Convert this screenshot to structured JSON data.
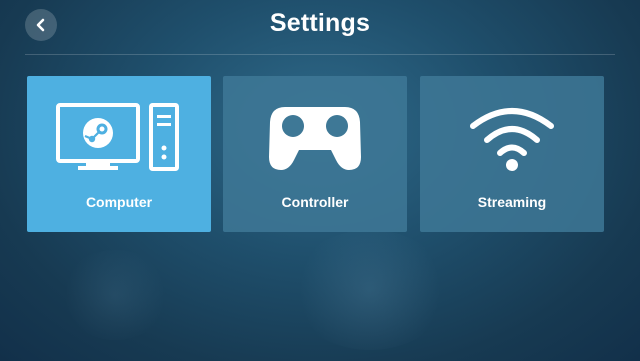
{
  "header": {
    "title": "Settings",
    "back_icon": "chevron-left-icon"
  },
  "tiles": [
    {
      "label": "Computer",
      "icon": "computer-icon",
      "selected": true
    },
    {
      "label": "Controller",
      "icon": "gamepad-icon",
      "selected": false
    },
    {
      "label": "Streaming",
      "icon": "wifi-icon",
      "selected": false
    }
  ],
  "colors": {
    "selected_tile": "#4eb0e1",
    "tile": "#3e7896",
    "background": "#1f4f6c"
  }
}
